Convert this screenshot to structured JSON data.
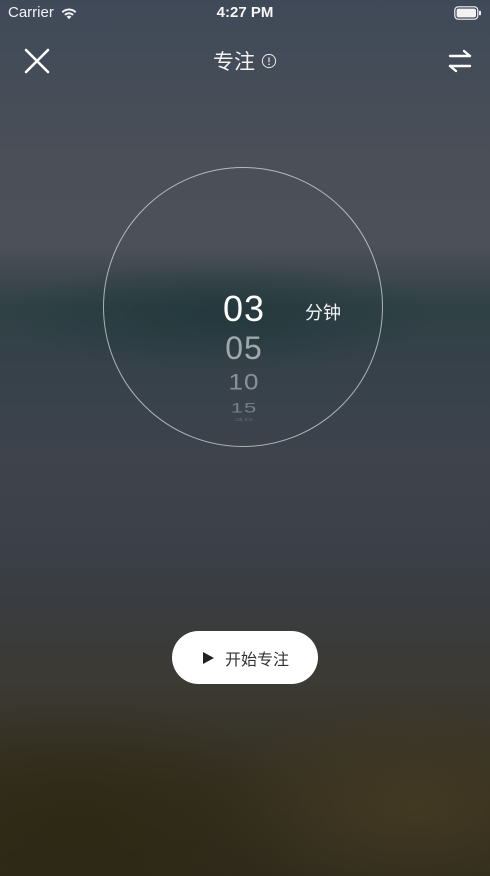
{
  "status_bar": {
    "carrier": "Carrier",
    "time": "4:27 PM",
    "wifi_icon": "wifi-icon",
    "battery_icon": "battery-icon"
  },
  "nav": {
    "title": "专注",
    "close_icon": "close-icon",
    "info_icon": "info-icon",
    "switch_icon": "switch-arrows-icon"
  },
  "timer": {
    "minutes_options": [
      "03",
      "05",
      "10",
      "15",
      "30"
    ],
    "selected_value": "03",
    "unit": "分钟"
  },
  "start_button": {
    "label": "开始专注",
    "icon": "play-icon"
  },
  "colors": {
    "button_bg": "#ffffff",
    "button_text": "#333333",
    "dial_stroke": "#ffffff"
  }
}
